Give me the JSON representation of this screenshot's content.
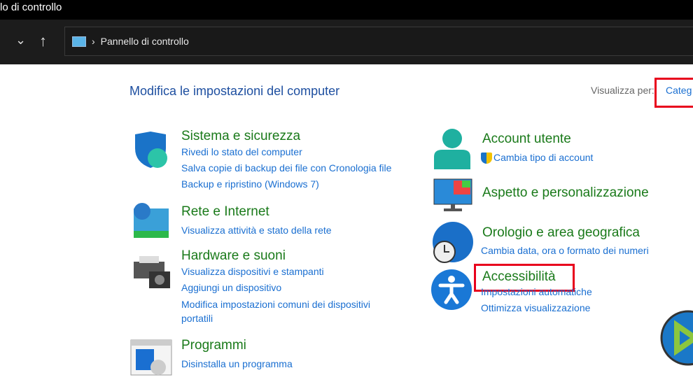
{
  "window": {
    "title": "lo di controllo"
  },
  "address": {
    "path": "Pannello di controllo"
  },
  "main": {
    "heading": "Modifica le impostazioni del computer",
    "view_by_label": "Visualizza per:",
    "view_by_value": "Categ"
  },
  "left": [
    {
      "title": "Sistema e sicurezza",
      "links": [
        "Rivedi lo stato del computer",
        "Salva copie di backup dei file con Cronologia file",
        "Backup e ripristino (Windows 7)"
      ]
    },
    {
      "title": "Rete e Internet",
      "links": [
        "Visualizza attività e stato della rete"
      ]
    },
    {
      "title": "Hardware e suoni",
      "links": [
        "Visualizza dispositivi e stampanti",
        "Aggiungi un dispositivo",
        "Modifica impostazioni comuni dei dispositivi",
        "portatili"
      ]
    },
    {
      "title": "Programmi",
      "links": [
        "Disinstalla un programma"
      ]
    }
  ],
  "right": [
    {
      "title": "Account utente",
      "links": [
        "Cambia tipo di account"
      ]
    },
    {
      "title": "Aspetto e personalizzazione",
      "links": []
    },
    {
      "title": "Orologio e area geografica",
      "links": [
        "Cambia data, ora o formato dei numeri"
      ]
    },
    {
      "title": "Accessibilità",
      "links": [
        "Impostazioni automatiche",
        "Ottimizza visualizzazione"
      ]
    }
  ],
  "colors": {
    "highlight": "#e8001c",
    "link": "#1a6fd1",
    "category": "#1a7a1a"
  }
}
